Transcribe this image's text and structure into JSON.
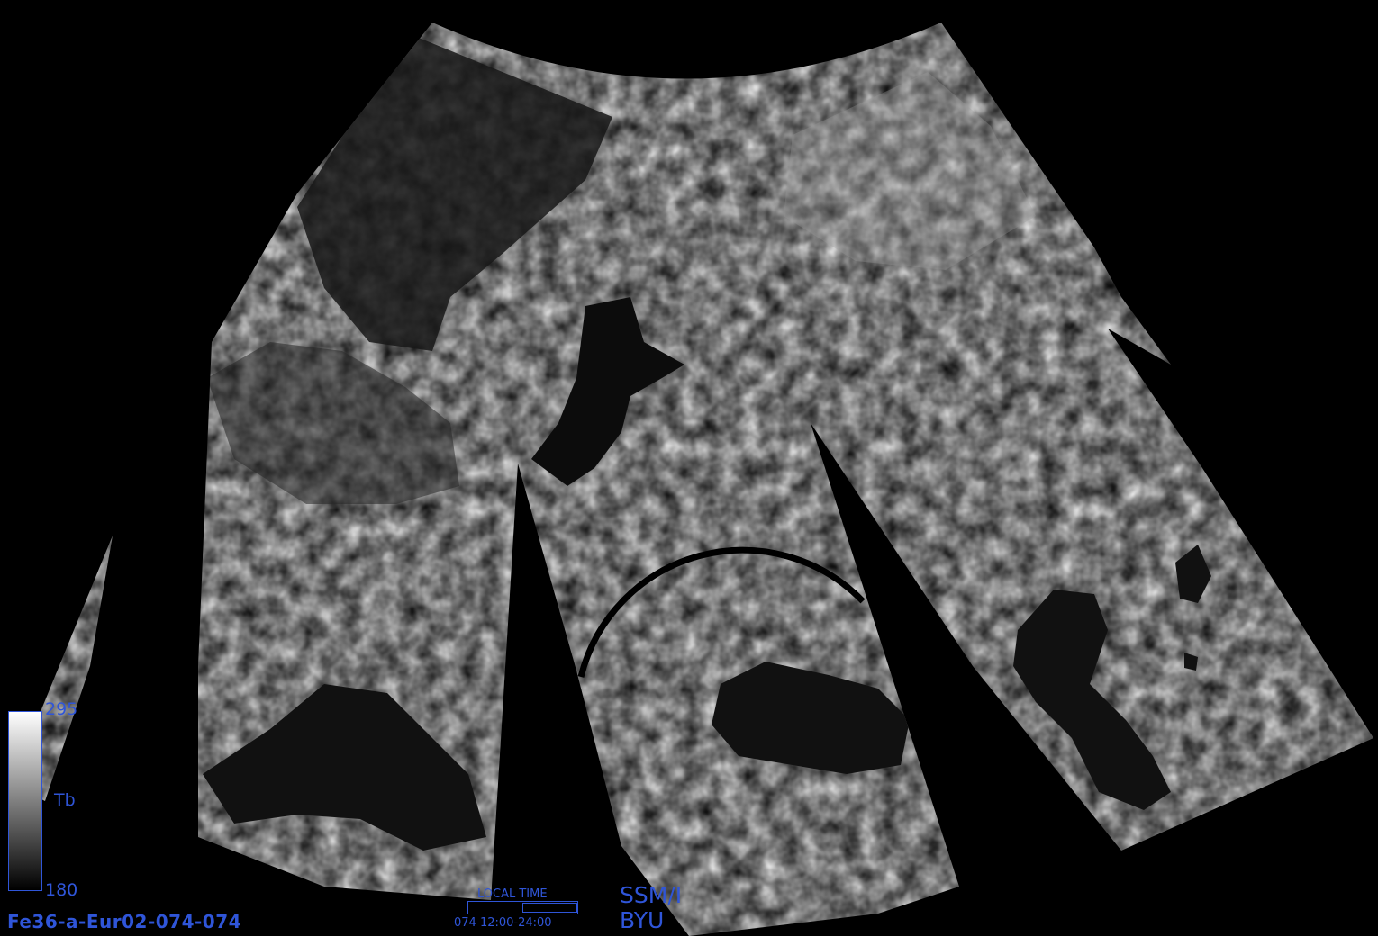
{
  "map": {
    "background_color": "#000000",
    "swath_color_light": "#d8d8d8",
    "water_color": "#141414"
  },
  "legend": {
    "max": "295",
    "mid": "Tb",
    "min": "180",
    "colorbar_top_color": "#ffffff",
    "colorbar_bottom_color": "#000000"
  },
  "product_id": "Fe36-a-Eur02-074-074",
  "local_time": {
    "label": "LOCAL TIME",
    "range": "074 12:00-24:00"
  },
  "sensor": "SSM/I",
  "org": "BYU",
  "accent_color": "#2f55d8"
}
